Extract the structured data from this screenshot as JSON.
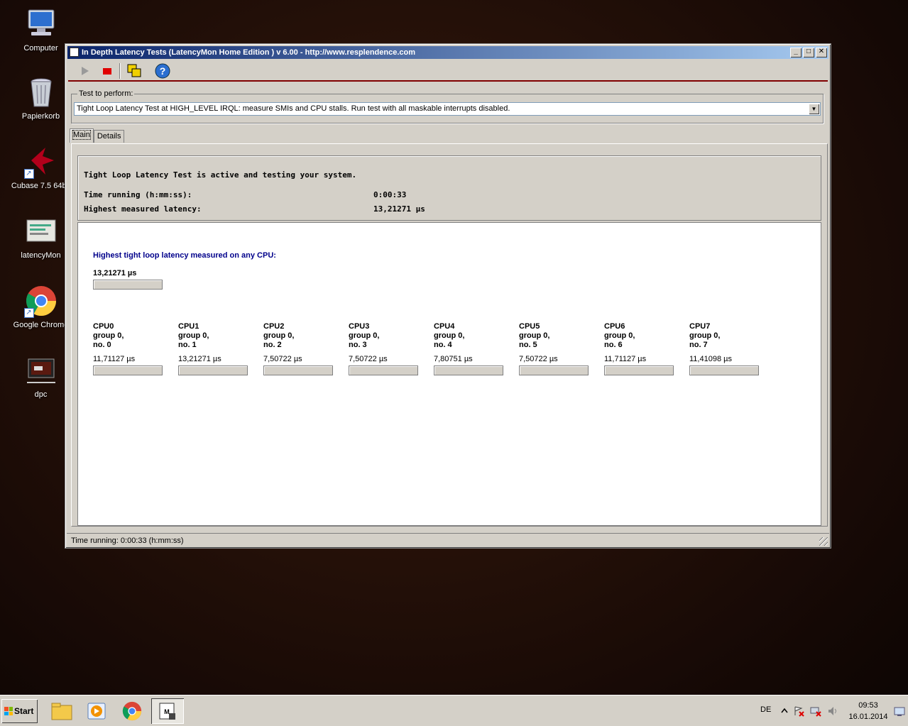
{
  "desktop": {
    "icons": [
      {
        "label": "Computer",
        "icon": "computer-icon"
      },
      {
        "label": "Papierkorb",
        "icon": "recycle-bin-icon"
      },
      {
        "label": "Cubase 7.5 64bit",
        "icon": "cubase-icon"
      },
      {
        "label": "latencyMon",
        "icon": "latencymon-icon"
      },
      {
        "label": "Google Chrome",
        "icon": "chrome-icon"
      },
      {
        "label": "dpc",
        "icon": "dpc-icon"
      }
    ]
  },
  "window": {
    "title": "In Depth Latency Tests  (LatencyMon Home Edition )  v 6.00 - http://www.resplendence.com",
    "controls": {
      "minimize": "_",
      "maximize": "□",
      "close": "✕"
    },
    "toolbar": {
      "start_icon": "play-icon",
      "stop_icon": "stop-icon",
      "copy_icon": "copy-windows-icon",
      "help_icon": "help-icon"
    },
    "test_group_label": "Test to perform:",
    "test_selected": "Tight Loop Latency Test at HIGH_LEVEL IRQL:  measure SMIs and CPU stalls. Run test with all maskable interrupts disabled.",
    "tabs": [
      {
        "label": "Main",
        "active": true
      },
      {
        "label": "Details",
        "active": false
      }
    ],
    "status": {
      "line1": "Tight Loop Latency Test is active and testing your system.",
      "time_label": "Time running (h:mm:ss):",
      "time_value": "0:00:33",
      "highest_label": "Highest measured latency:",
      "highest_value": "13,21271 µs"
    },
    "main": {
      "heading": "Highest tight loop latency measured on any CPU:",
      "overall_value": "13,21271 µs",
      "overall_fill": 0.0
    },
    "cpus": [
      {
        "name": "CPU0",
        "group": "group 0,",
        "no": "no. 0",
        "value": "11,71127 µs",
        "fill": 0.0
      },
      {
        "name": "CPU1",
        "group": "group 0,",
        "no": "no. 1",
        "value": "13,21271 µs",
        "fill": 0.0
      },
      {
        "name": "CPU2",
        "group": "group 0,",
        "no": "no. 2",
        "value": "7,50722 µs",
        "fill": 0.0
      },
      {
        "name": "CPU3",
        "group": "group 0,",
        "no": "no. 3",
        "value": "7,50722 µs",
        "fill": 0.0
      },
      {
        "name": "CPU4",
        "group": "group 0,",
        "no": "no. 4",
        "value": "7,80751 µs",
        "fill": 0.0
      },
      {
        "name": "CPU5",
        "group": "group 0,",
        "no": "no. 5",
        "value": "7,50722 µs",
        "fill": 0.0
      },
      {
        "name": "CPU6",
        "group": "group 0,",
        "no": "no. 6",
        "value": "11,71127 µs",
        "fill": 0.0
      },
      {
        "name": "CPU7",
        "group": "group 0,",
        "no": "no. 7",
        "value": "11,41098 µs",
        "fill": 0.0
      }
    ],
    "statusbar": "Time running: 0:00:33  (h:mm:ss)"
  },
  "taskbar": {
    "start_label": "Start",
    "apps": [
      "explorer-icon",
      "media-player-icon",
      "chrome-icon",
      "latencymon-icon"
    ],
    "active_app": 3,
    "language": "DE",
    "time": "09:53",
    "date": "16.01.2014"
  },
  "colors": {
    "heading_blue": "#00008b",
    "titlebar_start": "#0a246a",
    "titlebar_end": "#a6caf0",
    "stop_red": "#e00000"
  }
}
